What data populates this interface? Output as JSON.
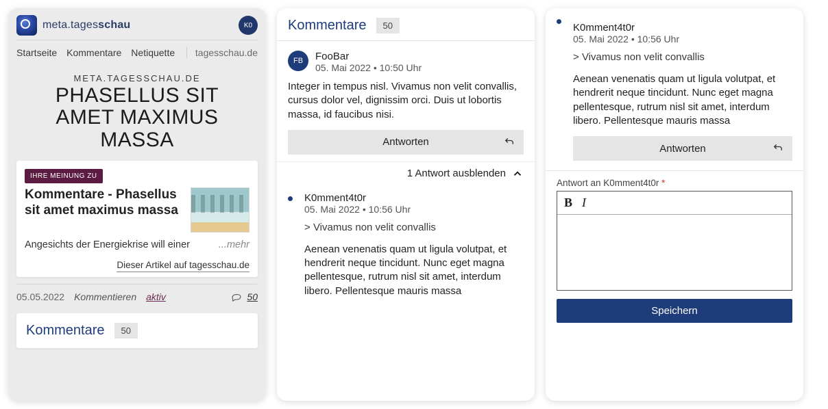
{
  "brand": {
    "pre": "meta.tages",
    "bold": "schau"
  },
  "avatar": "K0",
  "nav": {
    "home": "Startseite",
    "comments": "Kommentare",
    "netiquette": "Netiquette",
    "external": "tagesschau.de"
  },
  "article": {
    "domain": "META.TAGESSCHAU.DE",
    "headline": "PHASELLUS SIT AMET MAXIMUS MASSA",
    "badge": "IHRE MEINUNG ZU",
    "title": "Kommentare - Phasellus sit amet maximus massa",
    "lead": "Angesichts der Energiekrise will einer",
    "more": "...mehr",
    "source_link": "Dieser Artikel auf tagesschau.de",
    "date": "05.05.2022",
    "comment_label": "Kommentieren",
    "comment_state": "aktiv",
    "count": "50"
  },
  "comments_section": {
    "title": "Kommentare",
    "count": "50"
  },
  "c1": {
    "initials": "FB",
    "name": "FooBar",
    "date": "05. Mai 2022 • 10:50 Uhr",
    "body": "Integer in tempus nisl. Vivamus non velit convallis, cursus dolor vel, dignissim orci. Duis ut lobortis massa, id faucibus nisi.",
    "reply_btn": "Antworten",
    "toggle": "1 Antwort ausblenden"
  },
  "r1": {
    "name": "K0mment4t0r",
    "date": "05. Mai 2022 • 10:56 Uhr",
    "quote": "Vivamus non velit convallis",
    "body": "Aenean venenatis quam ut ligula volutpat, et hendrerit neque tincidunt. Nunc eget magna pellentesque, rutrum nisl sit amet, interdum libero. Pellentesque mauris massa",
    "reply_btn": "Antworten"
  },
  "form": {
    "label_prefix": "Antwort an ",
    "label_target": "K0mment4t0r",
    "required": "*",
    "save": "Speichern"
  }
}
